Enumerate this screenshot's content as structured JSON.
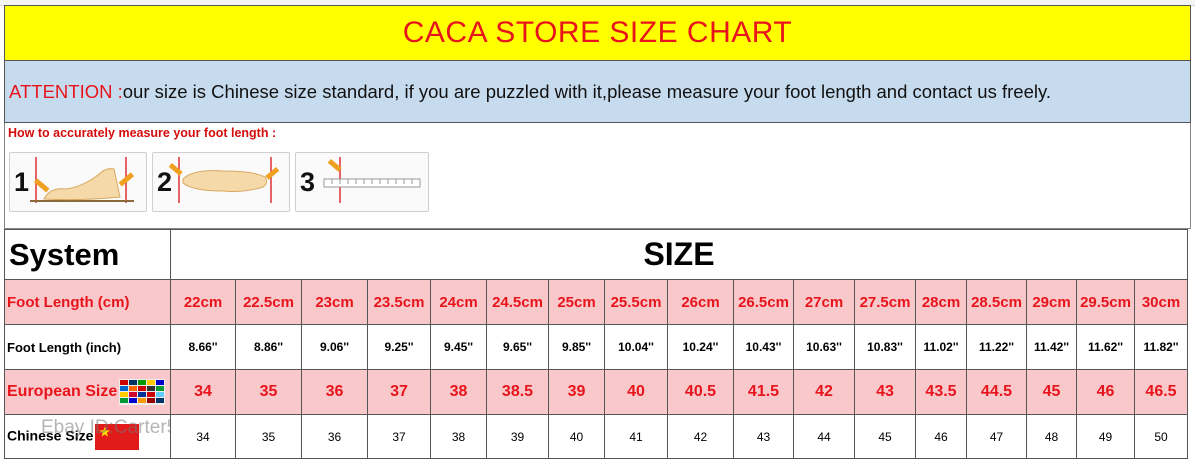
{
  "title": "CACA STORE SIZE CHART",
  "attention": {
    "label": "ATTENTION : ",
    "text": "our size is Chinese size standard, if you are puzzled with it,please measure your foot length and contact us freely."
  },
  "measure": {
    "title": "How to accurately measure your foot length :",
    "steps": [
      "1",
      "2",
      "3"
    ]
  },
  "table": {
    "system_label": "System",
    "size_label": "SIZE",
    "rows": [
      {
        "label": "Foot Length (cm)",
        "values": [
          "22cm",
          "22.5cm",
          "23cm",
          "23.5cm",
          "24cm",
          "24.5cm",
          "25cm",
          "25.5cm",
          "26cm",
          "26.5cm",
          "27cm",
          "27.5cm",
          "28cm",
          "28.5cm",
          "29cm",
          "29.5cm",
          "30cm"
        ]
      },
      {
        "label": "Foot Length (inch)",
        "values": [
          "8.66''",
          "8.86''",
          "9.06''",
          "9.25''",
          "9.45''",
          "9.65''",
          "9.85''",
          "10.04''",
          "10.24''",
          "10.43''",
          "10.63''",
          "10.83''",
          "11.02''",
          "11.22''",
          "11.42''",
          "11.62''",
          "11.82''"
        ]
      },
      {
        "label": "European Size",
        "values": [
          "34",
          "35",
          "36",
          "37",
          "38",
          "38.5",
          "39",
          "40",
          "40.5",
          "41.5",
          "42",
          "43",
          "43.5",
          "44.5",
          "45",
          "46",
          "46.5"
        ]
      },
      {
        "label": "Chinese Size",
        "values": [
          "34",
          "35",
          "36",
          "37",
          "38",
          "39",
          "40",
          "41",
          "42",
          "43",
          "44",
          "45",
          "46",
          "47",
          "48",
          "49",
          "50"
        ]
      }
    ]
  },
  "watermark": "Ebay ID:Carter515",
  "icons": [
    "eu-flags-icon",
    "china-flag-icon",
    "foot-measure-icon",
    "ruler-icon"
  ],
  "colors": {
    "title_bg": "#ffff00",
    "title_text": "#e8141c",
    "attention_bg": "#c7dbef",
    "pink_row": "#f8c8cb",
    "red_text": "#e8141c"
  }
}
